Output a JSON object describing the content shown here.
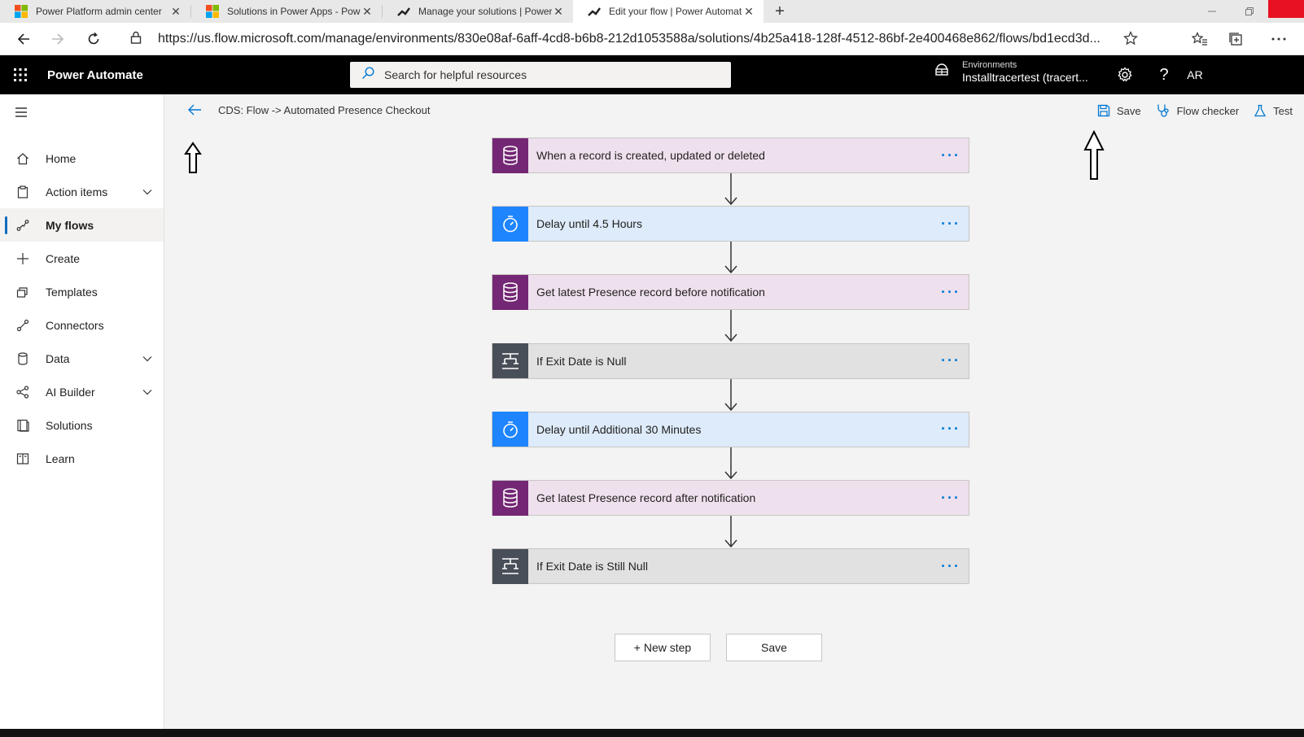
{
  "browser": {
    "tabs": [
      {
        "title": "Power Platform admin center",
        "icon": "microsoft-logo-icon",
        "close": "✕"
      },
      {
        "title": "Solutions in Power Apps - Power",
        "icon": "microsoft-logo-icon",
        "close": "✕"
      },
      {
        "title": "Manage your solutions | Power A",
        "icon": "power-automate-icon",
        "close": "✕"
      },
      {
        "title": "Edit your flow | Power Automate",
        "icon": "power-automate-icon",
        "close": "✕"
      }
    ],
    "new_tab": "+",
    "url": "https://us.flow.microsoft.com/manage/environments/830e08af-6aff-4cd8-b6b8-212d1053588a/solutions/4b25a418-128f-4512-86bf-2e400468e862/flows/bd1ecd3d..."
  },
  "header": {
    "app_name": "Power Automate",
    "search_placeholder": "Search for helpful resources",
    "environment_label": "Environments",
    "environment_name": "Installtracertest (tracert...",
    "help": "?",
    "avatar_initials": "AR"
  },
  "sidenav": {
    "items": [
      {
        "label": "Home",
        "icon": "home-icon",
        "selected": false,
        "expandable": false
      },
      {
        "label": "Action items",
        "icon": "clipboard-icon",
        "selected": false,
        "expandable": true
      },
      {
        "label": "My flows",
        "icon": "flow-icon",
        "selected": true,
        "expandable": false
      },
      {
        "label": "Create",
        "icon": "plus-icon",
        "selected": false,
        "expandable": false
      },
      {
        "label": "Templates",
        "icon": "templates-icon",
        "selected": false,
        "expandable": false
      },
      {
        "label": "Connectors",
        "icon": "connector-icon",
        "selected": false,
        "expandable": false
      },
      {
        "label": "Data",
        "icon": "database-icon",
        "selected": false,
        "expandable": true
      },
      {
        "label": "AI Builder",
        "icon": "ai-builder-icon",
        "selected": false,
        "expandable": true
      },
      {
        "label": "Solutions",
        "icon": "solutions-icon",
        "selected": false,
        "expandable": false
      },
      {
        "label": "Learn",
        "icon": "book-icon",
        "selected": false,
        "expandable": false
      }
    ]
  },
  "commandbar": {
    "flow_name": "CDS: Flow -> Automated Presence Checkout",
    "save": "Save",
    "flow_checker": "Flow checker",
    "test": "Test"
  },
  "steps": [
    {
      "title": "When a record is created, updated or deleted",
      "kind": "cds",
      "icon": "database-icon"
    },
    {
      "title": "Delay until 4.5 Hours",
      "kind": "delay",
      "icon": "timer-icon"
    },
    {
      "title": "Get latest Presence record before notification",
      "kind": "cds",
      "icon": "database-icon"
    },
    {
      "title": "If Exit Date is Null",
      "kind": "cond",
      "icon": "condition-icon"
    },
    {
      "title": "Delay until Additional 30 Minutes",
      "kind": "delay",
      "icon": "timer-icon"
    },
    {
      "title": "Get latest Presence record after notification",
      "kind": "cds",
      "icon": "database-icon"
    },
    {
      "title": "If Exit Date is Still Null",
      "kind": "cond",
      "icon": "condition-icon"
    }
  ],
  "canvas_buttons": {
    "new_step": "+ New step",
    "save": "Save"
  },
  "colors": {
    "cds_icon_bg": "#742774",
    "cds_card_bg": "#efe0ee",
    "delay_icon_bg": "#1f85ff",
    "delay_card_bg": "#ddebfa",
    "cond_icon_bg": "#484f58",
    "cond_card_bg": "#e1e1e1",
    "accent": "#0078d4"
  }
}
